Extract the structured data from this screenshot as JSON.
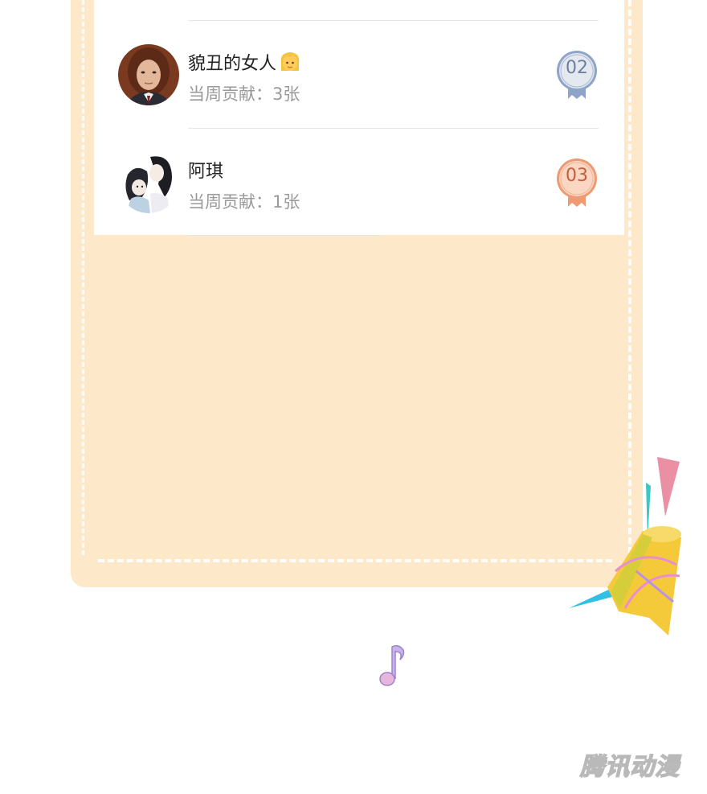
{
  "ranking": {
    "entries": [
      {
        "rank": "02",
        "name": "貌丑的女人",
        "contribution": "当周贡献：3张",
        "medal_color": "#8fa4c9",
        "medal_fill": "#e4e8ef"
      },
      {
        "rank": "03",
        "name": "阿琪",
        "contribution": "当周贡献：1张",
        "medal_color": "#ee9a72",
        "medal_fill": "#fbd6c3"
      }
    ]
  },
  "icons": {
    "woman_emoji": "woman-emoji-icon",
    "party_popper": "party-popper-icon",
    "music_note": "music-note-icon"
  },
  "watermark": "腾讯动漫",
  "colors": {
    "card_bg": "#fde9c9",
    "panel_bg": "#ffffff"
  }
}
